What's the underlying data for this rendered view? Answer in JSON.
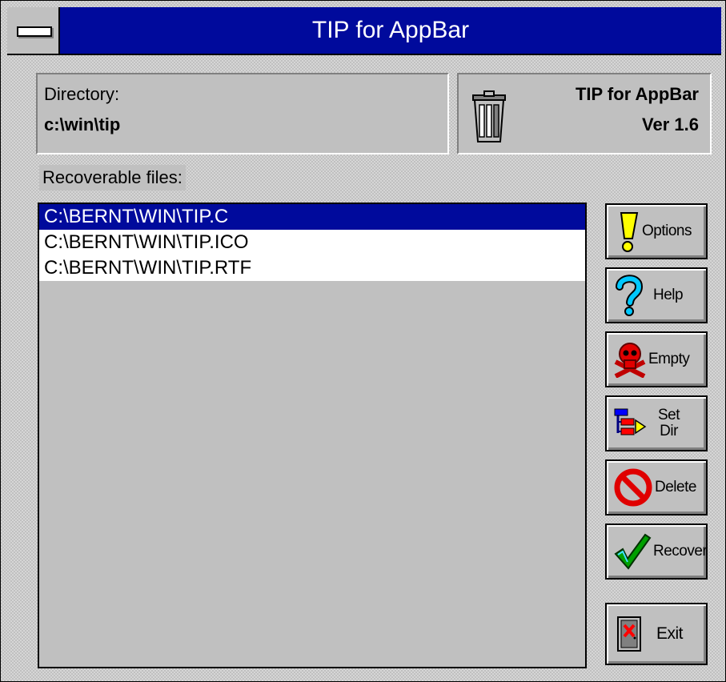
{
  "window": {
    "title": "TIP for AppBar"
  },
  "directory": {
    "label": "Directory:",
    "value": "c:\\win\\tip"
  },
  "app_info": {
    "name": "TIP for AppBar",
    "version": "Ver 1.6",
    "icon": "trash-can-icon"
  },
  "recoverable": {
    "label": "Recoverable files:",
    "files": [
      {
        "path": "C:\\BERNT\\WIN\\TIP.C",
        "selected": true
      },
      {
        "path": "C:\\BERNT\\WIN\\TIP.ICO",
        "selected": false
      },
      {
        "path": "C:\\BERNT\\WIN\\TIP.RTF",
        "selected": false
      }
    ]
  },
  "buttons": {
    "options": {
      "label": "Options",
      "icon": "exclamation-icon"
    },
    "help": {
      "label": "Help",
      "icon": "question-mark-icon"
    },
    "empty": {
      "label": "Empty",
      "icon": "skull-crossbones-icon"
    },
    "set_dir": {
      "line1": "Set",
      "line2": "Dir",
      "icon": "directory-tree-icon"
    },
    "delete": {
      "label": "Delete",
      "icon": "no-symbol-icon"
    },
    "recover": {
      "label": "Recover",
      "icon": "checkmark-icon"
    },
    "exit": {
      "label": "Exit",
      "icon": "exit-door-icon"
    }
  },
  "colors": {
    "titlebar": "#000a9c",
    "selection": "#000a9c",
    "face": "#c0c0c0"
  }
}
